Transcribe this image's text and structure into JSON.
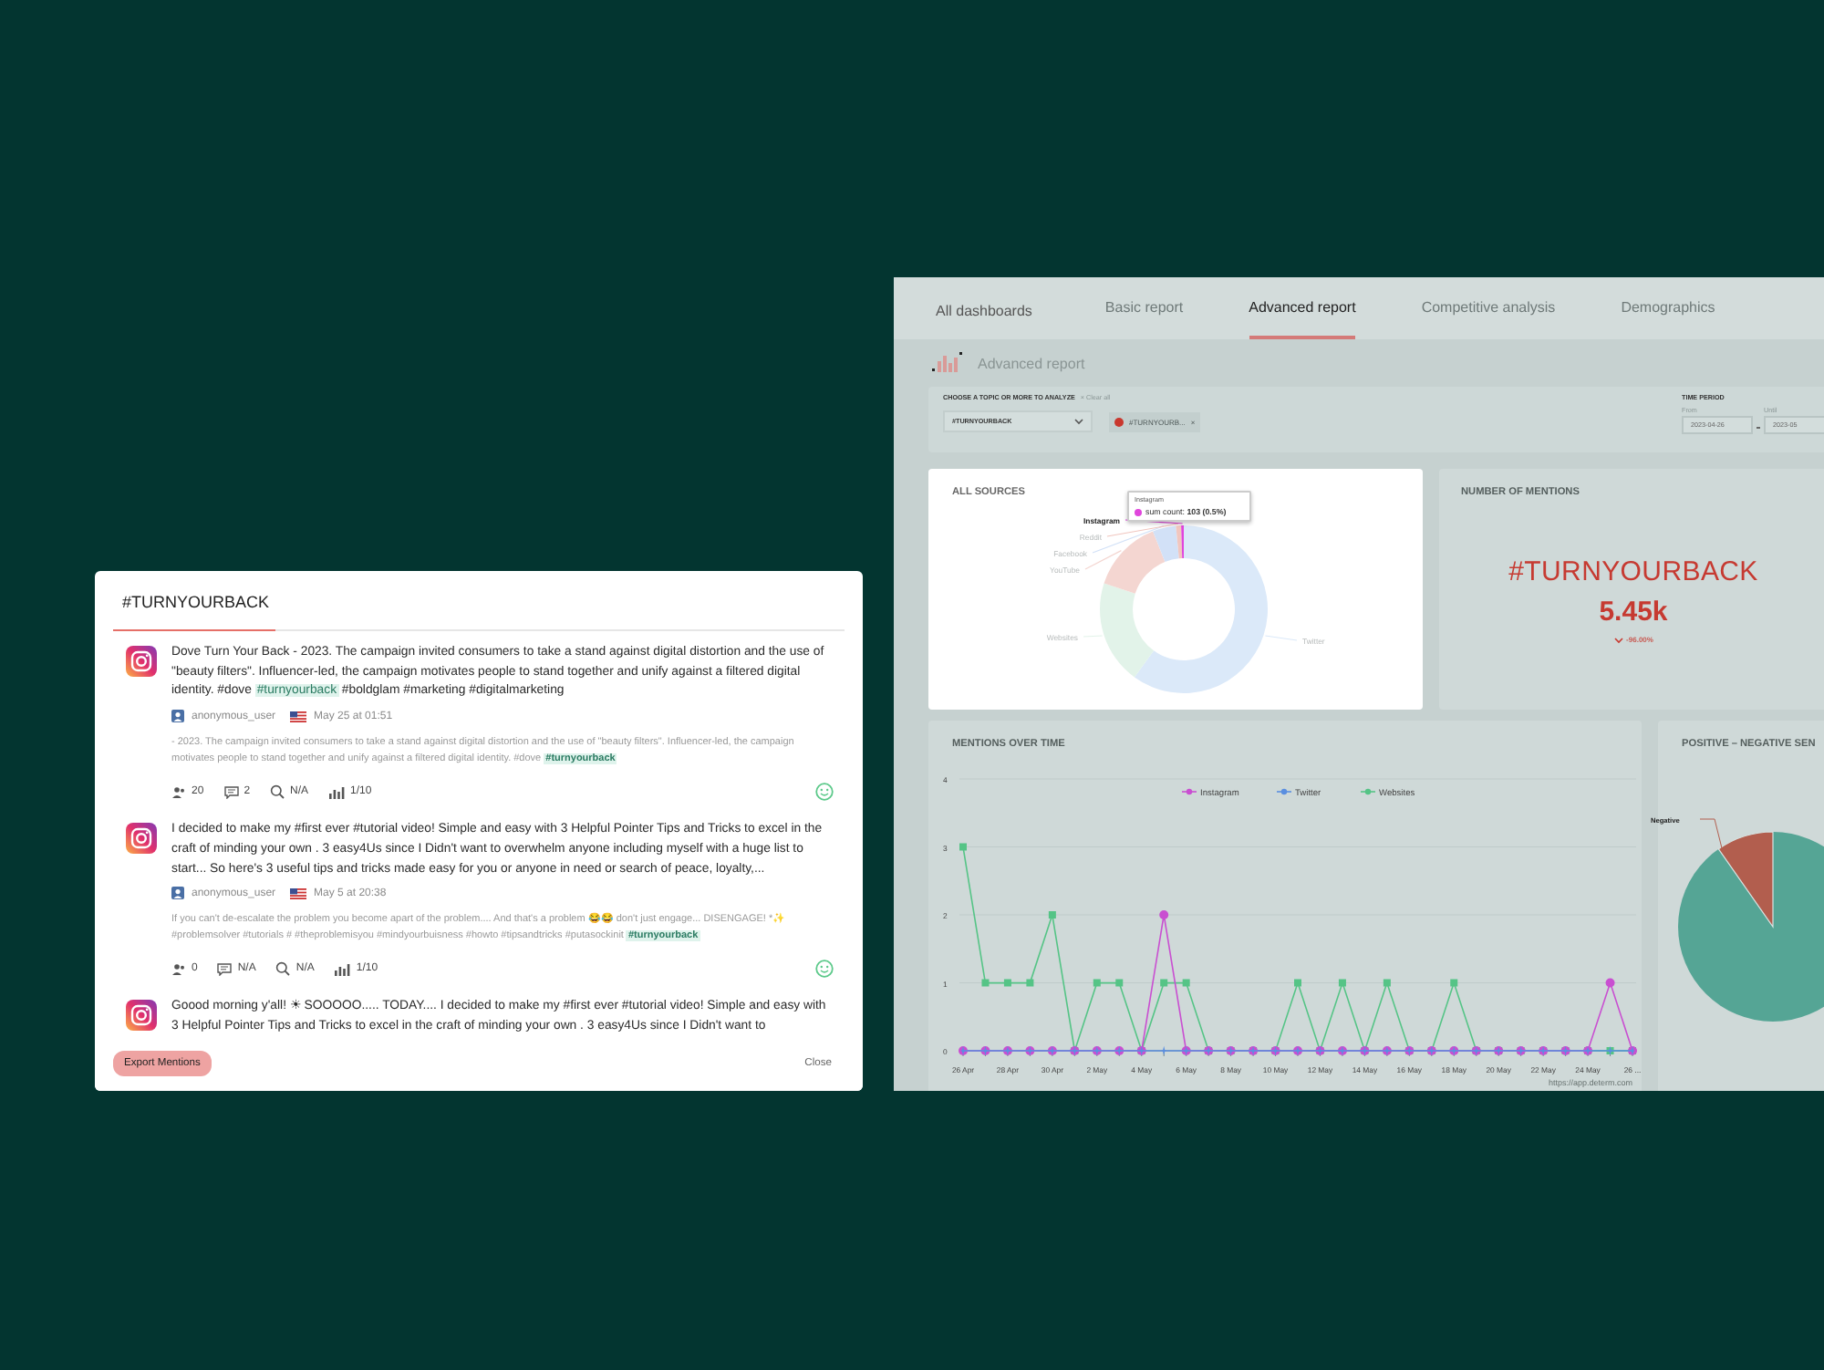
{
  "mentions_modal": {
    "title": "#TURNYOURBACK",
    "posts": [
      {
        "segments": [
          {
            "text": "Dove Turn Your Back - 2023. The campaign invited consumers to take a stand against digital distortion and the use of \"beauty filters\". Influencer-led, the campaign motivates people to stand together and unify against a filtered digital identity. #dove ",
            "highlighted": false
          },
          {
            "text": "#turnyourback",
            "highlighted": true
          },
          {
            "text": " #boldglam #marketing #digitalmarketing",
            "highlighted": false
          }
        ],
        "author": "anonymous_user",
        "date": "May 25 at 01:51",
        "snippet": [
          {
            "text": "- 2023. The campaign invited consumers to take a stand against digital distortion and the use of \"beauty filters\". Influencer-led, the campaign motivates people to stand together and unify against a filtered digital identity. #dove ",
            "highlighted": false
          },
          {
            "text": "#turnyourback",
            "highlighted": true
          }
        ],
        "stats": [
          {
            "kind": "reach",
            "value": "20"
          },
          {
            "kind": "comments",
            "value": "2"
          },
          {
            "kind": "search",
            "value": "N/A"
          },
          {
            "kind": "influence",
            "value": "1/10"
          }
        ]
      },
      {
        "segments": [
          {
            "text": "I decided to make my #first ever #tutorial video! Simple and easy with 3 Helpful Pointer Tips and Tricks to excel in the craft of minding your own . 3 easy4Us since I Didn't want to overwhelm anyone including myself with a huge list to start... So here's 3 useful tips and tricks made easy for you or anyone in need or search of peace, loyalty,...",
            "highlighted": false
          }
        ],
        "author": "anonymous_user",
        "date": "May 5 at 20:38",
        "snippet": [
          {
            "text": "If you can't de-escalate the problem you become apart of the problem.... And that's a problem 😂😂 don't just engage... DISENGAGE! *✨ #problemsolver #tutorials # #theproblemisyou #mindyourbuisness #howto #tipsandtricks #putasockinit ",
            "highlighted": false
          },
          {
            "text": "#turnyourback",
            "highlighted": true
          }
        ],
        "stats": [
          {
            "kind": "reach",
            "value": "0"
          },
          {
            "kind": "comments",
            "value": "N/A"
          },
          {
            "kind": "search",
            "value": "N/A"
          },
          {
            "kind": "influence",
            "value": "1/10"
          }
        ]
      },
      {
        "segments": [
          {
            "text": "Goood morning y'all! ☀ SOOOOO..... TODAY.... I decided to make my #first ever #tutorial video! Simple and easy with 3 Helpful Pointer Tips and Tricks to excel in the craft of minding your own . 3 easy4Us since I Didn't want to",
            "highlighted": false
          }
        ]
      }
    ],
    "export_button": "Export Mentions",
    "close_button": "Close"
  },
  "dashboard": {
    "tabs": [
      {
        "label": "All dashboards",
        "selected": false
      },
      {
        "label": "Basic report",
        "selected": false
      },
      {
        "label": "Advanced report",
        "selected": true
      },
      {
        "label": "Competitive analysis",
        "selected": false
      },
      {
        "label": "Demographics",
        "selected": false
      }
    ],
    "page_title": "Advanced report",
    "topic_filter": {
      "label": "CHOOSE A TOPIC OR MORE TO ANALYZE",
      "clear": "× Clear all",
      "select_value": "#TURNYOURBACK",
      "chip": "#TURNYOURB...",
      "chip_close": "×"
    },
    "time_period": {
      "label": "TIME PERIOD",
      "from_label": "From",
      "from": "2023-04-26",
      "until_label": "Until",
      "until": "2023-05"
    },
    "all_sources": {
      "title": "ALL SOURCES",
      "chart_data": {
        "type": "donut",
        "categories": [
          "Twitter",
          "Websites",
          "YouTube",
          "Facebook",
          "Reddit",
          "Instagram"
        ],
        "values": [
          60,
          20,
          14,
          4.5,
          1,
          0.5
        ]
      },
      "tooltip": {
        "title": "Instagram",
        "text": "sum count: **103 (0.5%)**"
      }
    },
    "number_of_mentions": {
      "title": "NUMBER OF MENTIONS",
      "topic": "#TURNYOURBACK",
      "count": "5.45k",
      "change": "-96.00%"
    },
    "mentions_over_time": {
      "title": "MENTIONS OVER TIME",
      "chart_data": {
        "type": "line",
        "categories": [
          "26 Apr",
          null,
          "28 Apr",
          null,
          "30 Apr",
          null,
          "2 May",
          null,
          "4 May",
          null,
          "6 May",
          null,
          "8 May",
          null,
          "10 May",
          null,
          "12 May",
          null,
          "14 May",
          null,
          "16 May",
          null,
          "18 May",
          null,
          "20 May",
          null,
          "22 May",
          null,
          "24 May",
          null,
          "26 ..."
        ],
        "series": [
          {
            "name": "Instagram",
            "color": "#c94fd1",
            "marker": "circle",
            "values": [
              0,
              0,
              0,
              0,
              0,
              0,
              0,
              0,
              0,
              2,
              0,
              0,
              0,
              0,
              0,
              0,
              0,
              0,
              0,
              0,
              0,
              0,
              0,
              0,
              0,
              0,
              0,
              0,
              0,
              1,
              0
            ]
          },
          {
            "name": "Twitter",
            "color": "#5a8fe0",
            "marker": "star",
            "values": [
              0,
              0,
              0,
              0,
              0,
              0,
              0,
              0,
              0,
              0,
              0,
              0,
              0,
              0,
              0,
              0,
              0,
              0,
              0,
              0,
              0,
              0,
              0,
              0,
              0,
              0,
              0,
              0,
              0,
              0,
              0
            ]
          },
          {
            "name": "Websites",
            "color": "#55c486",
            "marker": "square",
            "values": [
              3,
              1,
              1,
              1,
              2,
              0,
              1,
              1,
              0,
              1,
              1,
              0,
              0,
              0,
              0,
              1,
              0,
              1,
              0,
              1,
              0,
              0,
              1,
              0,
              0,
              0,
              0,
              0,
              0,
              0,
              0
            ]
          }
        ],
        "ylim": [
          0,
          4
        ],
        "yticks": [
          0,
          1,
          2,
          3,
          4
        ],
        "grid": true,
        "legend": "top"
      },
      "source": "https://app.determ.com"
    },
    "sentiment": {
      "title": "POSITIVE – NEGATIVE SEN",
      "label": "Negative"
    }
  }
}
